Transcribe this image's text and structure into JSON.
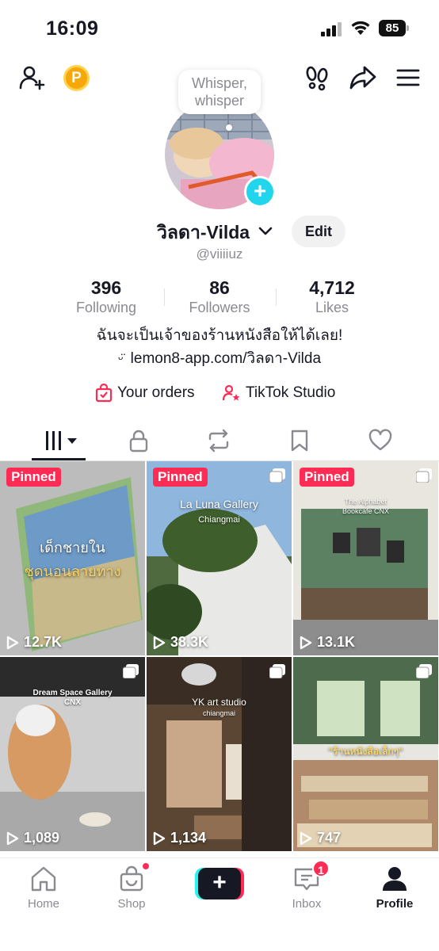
{
  "status_bar": {
    "time": "16:09",
    "battery": "85"
  },
  "header": {
    "coin_label": "P"
  },
  "profile": {
    "whisper_line1": "Whisper,",
    "whisper_line2": "whisper",
    "display_name": "วิลดา-Vilda",
    "edit_label": "Edit",
    "username": "@viiiiuz",
    "stats": [
      {
        "value": "396",
        "label": "Following"
      },
      {
        "value": "86",
        "label": "Followers"
      },
      {
        "value": "4,712",
        "label": "Likes"
      }
    ],
    "bio": "ฉันจะเป็นเจ้าของร้านหนังสือให้ได้เลย!",
    "link": "lemon8-app.com/วิลดา-Vilda",
    "shortcuts": [
      {
        "label": "Your orders",
        "icon": "shopping-bag-check-icon"
      },
      {
        "label": "TikTok Studio",
        "icon": "person-star-icon"
      }
    ]
  },
  "tabs": [
    {
      "icon": "videos-grid-icon",
      "active": true
    },
    {
      "icon": "lock-icon"
    },
    {
      "icon": "repost-icon"
    },
    {
      "icon": "bookmark-icon"
    },
    {
      "icon": "heart-icon"
    }
  ],
  "videos": [
    {
      "pinned": "Pinned",
      "views": "12.7K",
      "title_line1": "เด็กชายใน",
      "title_line2": "ชุดนอนลายทาง"
    },
    {
      "pinned": "Pinned",
      "views": "38.3K",
      "title_line1": "La Luna Gallery",
      "title_line2": "Chiangmai"
    },
    {
      "pinned": "Pinned",
      "views": "13.1K",
      "title_line1": "The Alphabet",
      "title_line2": "Bookcafe CNX"
    },
    {
      "views": "1,089",
      "title_line1": "Dream Space Gallery",
      "title_line2": "CNX"
    },
    {
      "views": "1,134",
      "title_line1": "YK art studio",
      "title_line2": "chiangmai"
    },
    {
      "views": "747",
      "title_line1": "\"ร้านหนังสือเล็กๆ\""
    }
  ],
  "bottom_nav": [
    {
      "label": "Home",
      "icon": "home-icon"
    },
    {
      "label": "Shop",
      "icon": "shop-bag-icon"
    },
    {
      "label": "",
      "icon": "plus-icon"
    },
    {
      "label": "Inbox",
      "icon": "inbox-icon",
      "badge": "1"
    },
    {
      "label": "Profile",
      "icon": "profile-icon",
      "active": true
    }
  ],
  "colors": {
    "accent": "#fe2c55",
    "cyan": "#20d5ec",
    "text": "#161823",
    "muted": "#8a8b91"
  }
}
